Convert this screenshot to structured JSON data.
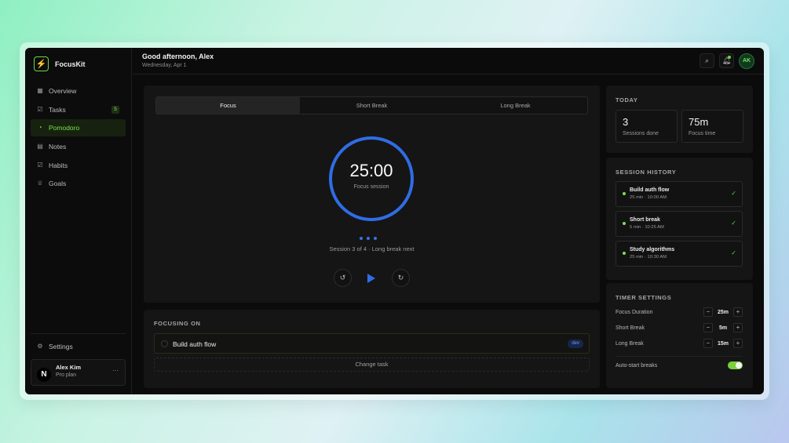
{
  "app": {
    "name": "FocusKit",
    "accent": "#7be04f",
    "timer_color": "#2f6de6"
  },
  "sidebar": {
    "items": [
      {
        "label": "Overview",
        "icon": "grid-icon"
      },
      {
        "label": "Tasks",
        "icon": "checkbox-icon",
        "badge": "5"
      },
      {
        "label": "Pomodoro",
        "icon": "timer-icon",
        "active": true
      },
      {
        "label": "Notes",
        "icon": "document-icon"
      },
      {
        "label": "Habits",
        "icon": "checkbox-icon"
      },
      {
        "label": "Goals",
        "icon": "trophy-icon"
      }
    ],
    "settings_label": "Settings",
    "user": {
      "initial": "N",
      "name": "Alex Kim",
      "plan": "Pro plan",
      "more": "···"
    }
  },
  "header": {
    "greeting": "Good afternoon, Alex",
    "date": "Wednesday, Apr 1",
    "avatar_initials": "AK"
  },
  "timer": {
    "tabs": [
      "Focus",
      "Short Break",
      "Long Break"
    ],
    "active_tab": "Focus",
    "time": "25:00",
    "label": "Focus session",
    "progress": 1.0,
    "session_text": "Session 3 of 4 · Long break next"
  },
  "focusing": {
    "title": "FOCUSING ON",
    "task": "Build auth flow",
    "tag": "dev",
    "change_label": "Change task"
  },
  "today": {
    "title": "TODAY",
    "stats": [
      {
        "value": "3",
        "label": "Sessions done"
      },
      {
        "value": "75m",
        "label": "Focus time"
      }
    ]
  },
  "history": {
    "title": "SESSION HISTORY",
    "items": [
      {
        "name": "Build auth flow",
        "meta": "25 min · 10:00 AM"
      },
      {
        "name": "Short break",
        "meta": "5 min · 10:25 AM"
      },
      {
        "name": "Study algorithms",
        "meta": "25 min · 10:30 AM"
      }
    ]
  },
  "settings": {
    "title": "TIMER SETTINGS",
    "rows": [
      {
        "label": "Focus Duration",
        "value": "25m"
      },
      {
        "label": "Short Break",
        "value": "5m"
      },
      {
        "label": "Long Break",
        "value": "15m"
      }
    ],
    "auto_start_label": "Auto-start breaks",
    "auto_start_on": true
  }
}
